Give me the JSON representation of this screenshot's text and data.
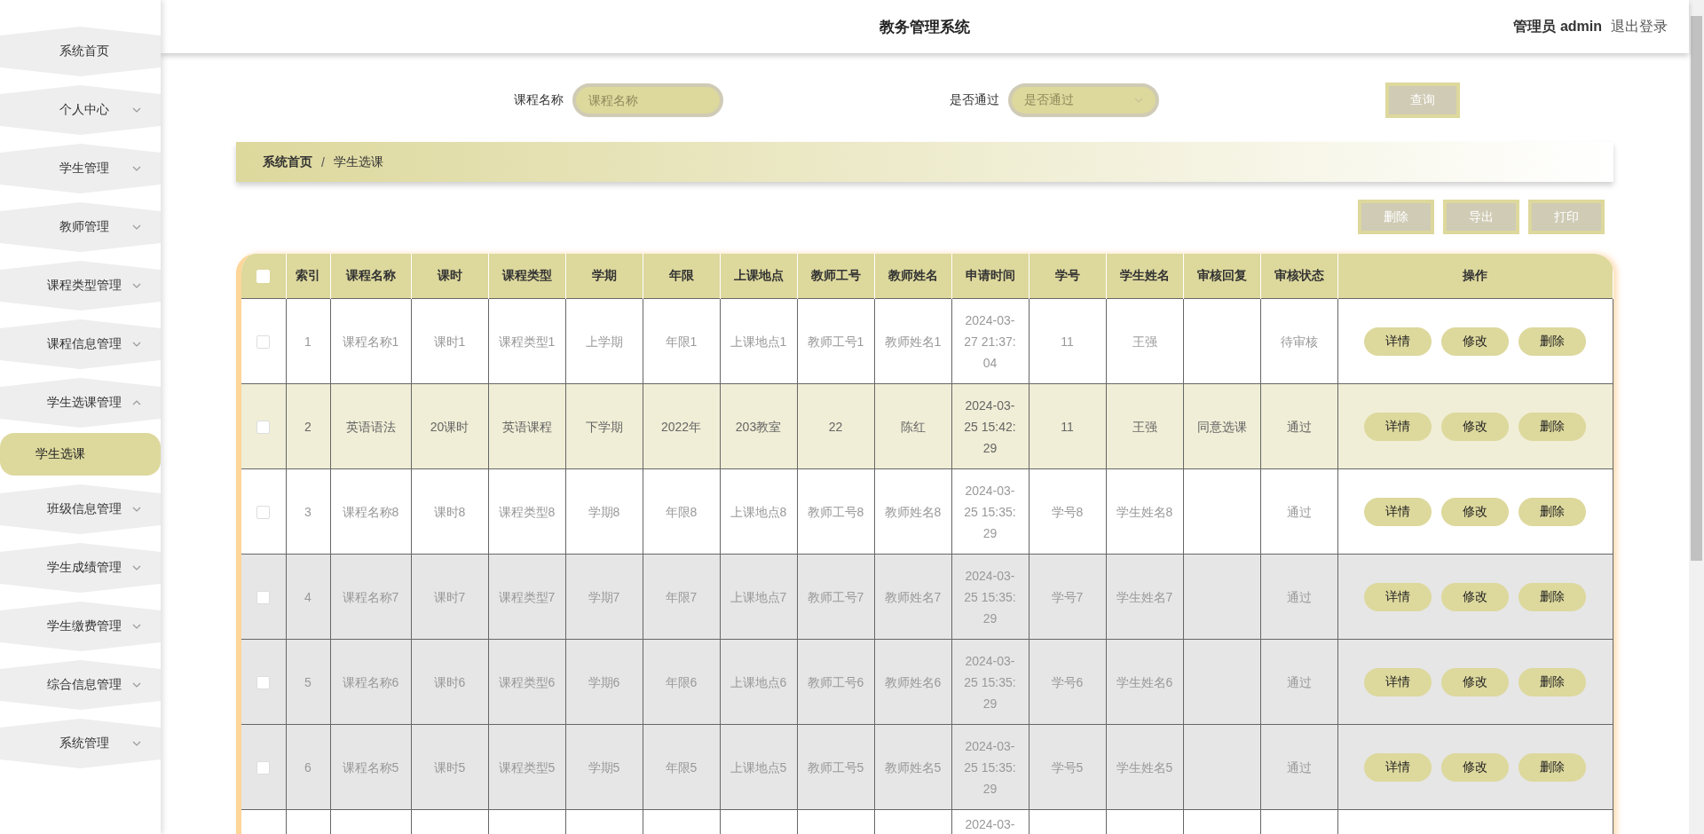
{
  "header": {
    "title": "教务管理系统",
    "role": "管理员",
    "username": "admin",
    "logout": "退出登录"
  },
  "sidebar": {
    "items": [
      {
        "kind": "link",
        "label": "系统首页"
      },
      {
        "kind": "group",
        "label": "个人中心",
        "expanded": false
      },
      {
        "kind": "group",
        "label": "学生管理",
        "expanded": false
      },
      {
        "kind": "group",
        "label": "教师管理",
        "expanded": false
      },
      {
        "kind": "group",
        "label": "课程类型管理",
        "expanded": false
      },
      {
        "kind": "group",
        "label": "课程信息管理",
        "expanded": false
      },
      {
        "kind": "group",
        "label": "学生选课管理",
        "expanded": true,
        "children": [
          {
            "label": "学生选课",
            "selected": true
          }
        ]
      },
      {
        "kind": "group",
        "label": "班级信息管理",
        "expanded": false
      },
      {
        "kind": "group",
        "label": "学生成绩管理",
        "expanded": false
      },
      {
        "kind": "group",
        "label": "学生缴费管理",
        "expanded": false
      },
      {
        "kind": "group",
        "label": "综合信息管理",
        "expanded": false
      },
      {
        "kind": "group",
        "label": "系统管理",
        "expanded": false
      }
    ]
  },
  "search": {
    "fields": [
      {
        "kind": "text",
        "label": "课程名称",
        "placeholder": "课程名称"
      },
      {
        "kind": "select",
        "label": "是否通过",
        "placeholder": "是否通过"
      }
    ],
    "button": "查询"
  },
  "breadcrumb": {
    "items": [
      "系统首页",
      "学生选课"
    ],
    "separator": "/"
  },
  "toolbar": [
    "删除",
    "导出",
    "打印"
  ],
  "table": {
    "all_checked": false,
    "columns": [
      "索引",
      "课程名称",
      "课时",
      "课程类型",
      "学期",
      "年限",
      "上课地点",
      "教师工号",
      "教师姓名",
      "申请时间",
      "学号",
      "学生姓名",
      "审核回复",
      "审核状态",
      "操作"
    ],
    "rows": [
      {
        "kind": "full",
        "checked": false,
        "selected": false,
        "shaded": false,
        "index": "1",
        "course_name": "课程名称1",
        "hours": "课时1",
        "course_type": "课程类型1",
        "term": "上学期",
        "years": "年限1",
        "location": "上课地点1",
        "teacher_id": "教师工号1",
        "teacher_name": "教师姓名1",
        "apply_time": "2024-03-27 21:37:04",
        "student_id": "11",
        "student_name": "王强",
        "review_status": "待审核",
        "actions": [
          "详情",
          "修改",
          "删除"
        ]
      },
      {
        "kind": "full",
        "checked": false,
        "selected": true,
        "shaded": false,
        "index": "2",
        "course_name": "英语语法",
        "hours": "20课时",
        "course_type": "英语课程",
        "term": "下学期",
        "years": "2022年",
        "location": "203教室",
        "teacher_id": "22",
        "teacher_name": "陈红",
        "apply_time": "2024-03-25 15:42:29",
        "student_id": "11",
        "student_name": "王强",
        "review_reply": "同意选课",
        "review_status": "通过",
        "actions": [
          "详情",
          "修改",
          "删除"
        ]
      },
      {
        "kind": "full",
        "checked": false,
        "selected": false,
        "shaded": false,
        "index": "3",
        "course_name": "课程名称8",
        "hours": "课时8",
        "course_type": "课程类型8",
        "term": "学期8",
        "years": "年限8",
        "location": "上课地点8",
        "teacher_id": "教师工号8",
        "teacher_name": "教师姓名8",
        "apply_time": "2024-03-25 15:35:29",
        "student_id": "学号8",
        "student_name": "学生姓名8",
        "review_status": "通过",
        "actions": [
          "详情",
          "修改",
          "删除"
        ]
      },
      {
        "kind": "full",
        "checked": false,
        "selected": false,
        "shaded": true,
        "index": "4",
        "course_name": "课程名称7",
        "hours": "课时7",
        "course_type": "课程类型7",
        "term": "学期7",
        "years": "年限7",
        "location": "上课地点7",
        "teacher_id": "教师工号7",
        "teacher_name": "教师姓名7",
        "apply_time": "2024-03-25 15:35:29",
        "student_id": "学号7",
        "student_name": "学生姓名7",
        "review_status": "通过",
        "actions": [
          "详情",
          "修改",
          "删除"
        ]
      },
      {
        "kind": "full",
        "checked": false,
        "selected": false,
        "shaded": true,
        "index": "5",
        "course_name": "课程名称6",
        "hours": "课时6",
        "course_type": "课程类型6",
        "term": "学期6",
        "years": "年限6",
        "location": "上课地点6",
        "teacher_id": "教师工号6",
        "teacher_name": "教师姓名6",
        "apply_time": "2024-03-25 15:35:29",
        "student_id": "学号6",
        "student_name": "学生姓名6",
        "review_status": "通过",
        "actions": [
          "详情",
          "修改",
          "删除"
        ]
      },
      {
        "kind": "full",
        "checked": false,
        "selected": false,
        "shaded": true,
        "index": "6",
        "course_name": "课程名称5",
        "hours": "课时5",
        "course_type": "课程类型5",
        "term": "学期5",
        "years": "年限5",
        "location": "上课地点5",
        "teacher_id": "教师工号5",
        "teacher_name": "教师姓名5",
        "apply_time": "2024-03-25 15:35:29",
        "student_id": "学号5",
        "student_name": "学生姓名5",
        "review_status": "通过",
        "actions": [
          "详情",
          "修改",
          "删除"
        ]
      },
      {
        "kind": "partial",
        "apply_time": "2024-03-"
      }
    ]
  }
}
